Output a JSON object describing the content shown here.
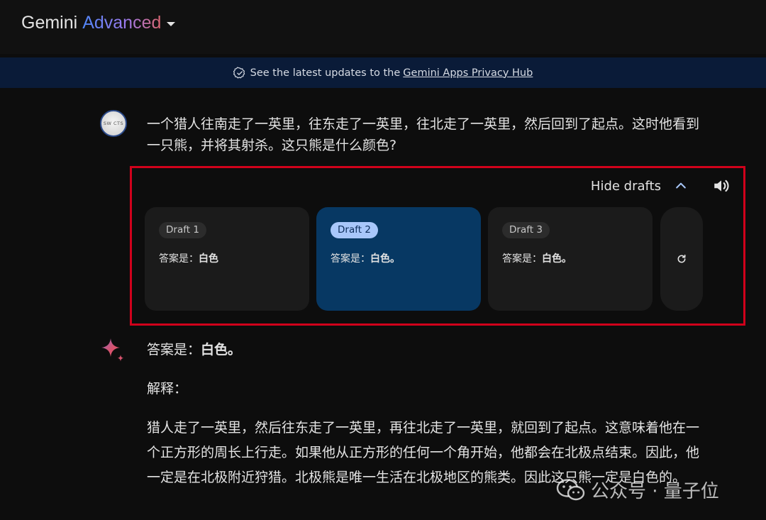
{
  "header": {
    "brand_name": "Gemini",
    "brand_tier": "Advanced",
    "dropdown_icon": "caret-down-icon"
  },
  "notice": {
    "icon": "verified-check-icon",
    "text": "See the latest updates to the",
    "link": "Gemini Apps Privacy Hub"
  },
  "user": {
    "avatar_text": "SW CTS",
    "query": "一个猎人往南走了一英里，往东走了一英里，往北走了一英里，然后回到了起点。这时他看到一只熊，并将其射杀。这只熊是什么颜色?"
  },
  "drafts": {
    "hide_label": "Hide drafts",
    "collapse_icon": "chevron-up-icon",
    "speaker_icon": "speaker-icon",
    "regenerate_icon": "refresh-icon",
    "items": [
      {
        "label": "Draft 1",
        "prefix": "答案是：",
        "answer": "白色",
        "active": false
      },
      {
        "label": "Draft 2",
        "prefix": "答案是：",
        "answer": "白色。",
        "active": true
      },
      {
        "label": "Draft 3",
        "prefix": "答案是：",
        "answer": "白色。",
        "active": false
      }
    ]
  },
  "response": {
    "icon": "gemini-sparkle-icon",
    "answer_prefix": "答案是：",
    "answer_bold": "白色。",
    "explanation_label": "解释：",
    "explanation": "猎人走了一英里，然后往东走了一英里，再往北走了一英里，就回到了起点。这意味着他在一个正方形的周长上行走。如果他从正方形的任何一个角开始，他都会在北极点结束。因此，他一定是在北极附近狩猎。北极熊是唯一生活在北极地区的熊类。因此这只熊一定是白色的。"
  },
  "watermark": {
    "text": "公众号 · 量子位",
    "icon": "wechat-icon"
  },
  "colors": {
    "highlight_border": "#d0011b",
    "active_draft": "#073863",
    "notice_bg": "#0a1b38"
  }
}
